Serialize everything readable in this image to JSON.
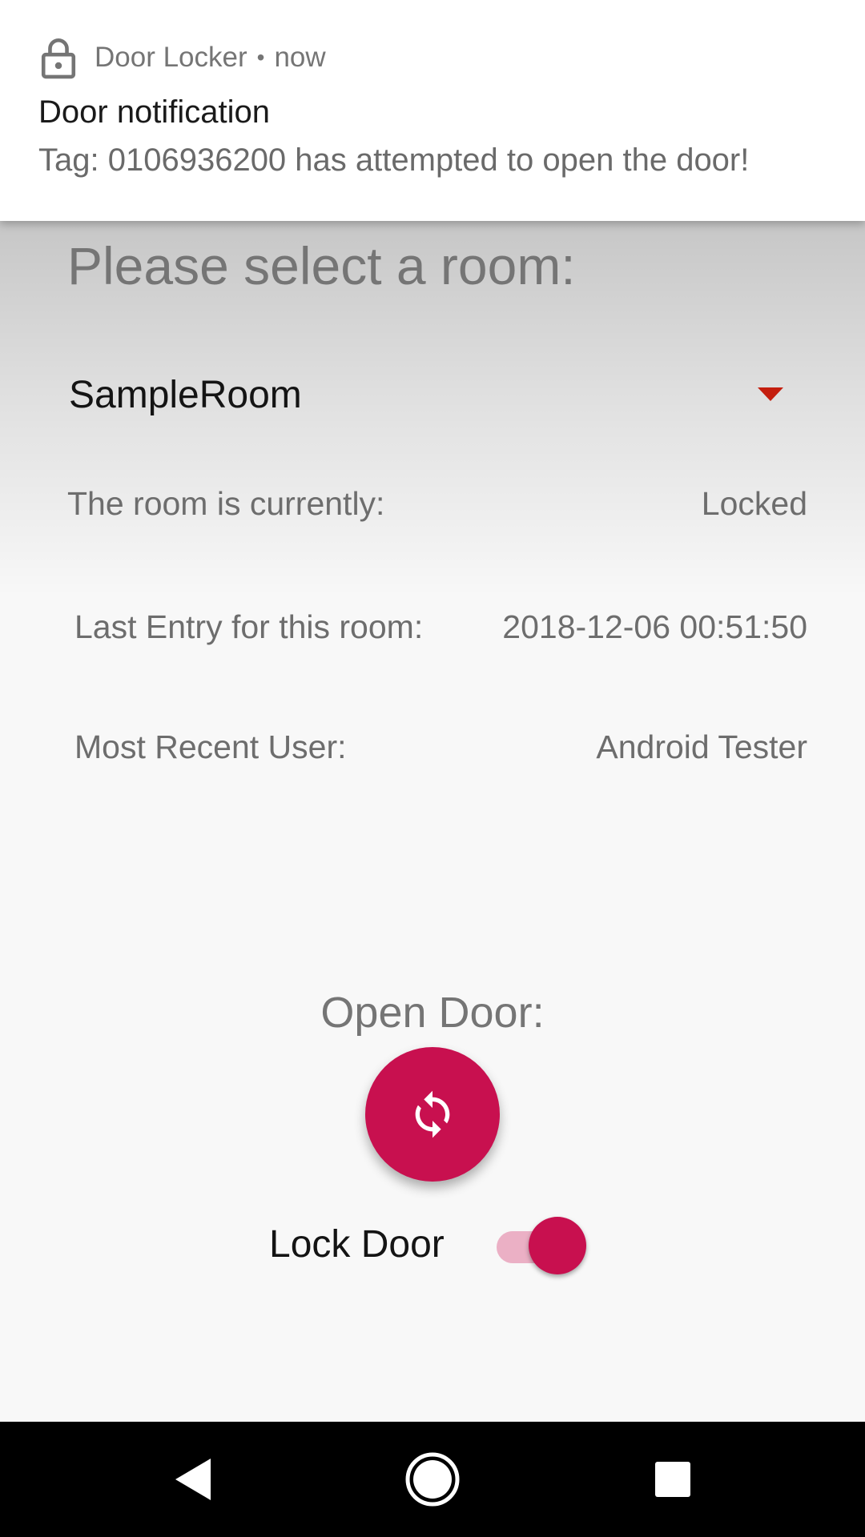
{
  "notification": {
    "app_name": "Door Locker",
    "separator": "•",
    "time": "now",
    "title": "Door notification",
    "body": "Tag: 0106936200 has attempted to open the door!",
    "icon": "lock-icon"
  },
  "main": {
    "title": "Please select a room:",
    "room_select": {
      "selected": "SampleRoom",
      "caret_icon": "dropdown-caret-icon"
    },
    "status": {
      "label": "The room is currently:",
      "value": "Locked"
    },
    "last_entry": {
      "label": "Last Entry for this room:",
      "value": "2018-12-06 00:51:50"
    },
    "recent_user": {
      "label": "Most Recent User:",
      "value": "Android Tester"
    },
    "open_door": {
      "label": "Open Door:",
      "button_icon": "refresh-icon"
    },
    "lock_door": {
      "label": "Lock Door",
      "checked": true
    }
  },
  "navbar": {
    "back_icon": "back-icon",
    "home_icon": "home-icon",
    "recents_icon": "recents-icon"
  },
  "colors": {
    "accent": "#c8104f",
    "accent_light": "#ebb0c5",
    "caret": "#c41e0e",
    "background": "#f8f8f8"
  }
}
